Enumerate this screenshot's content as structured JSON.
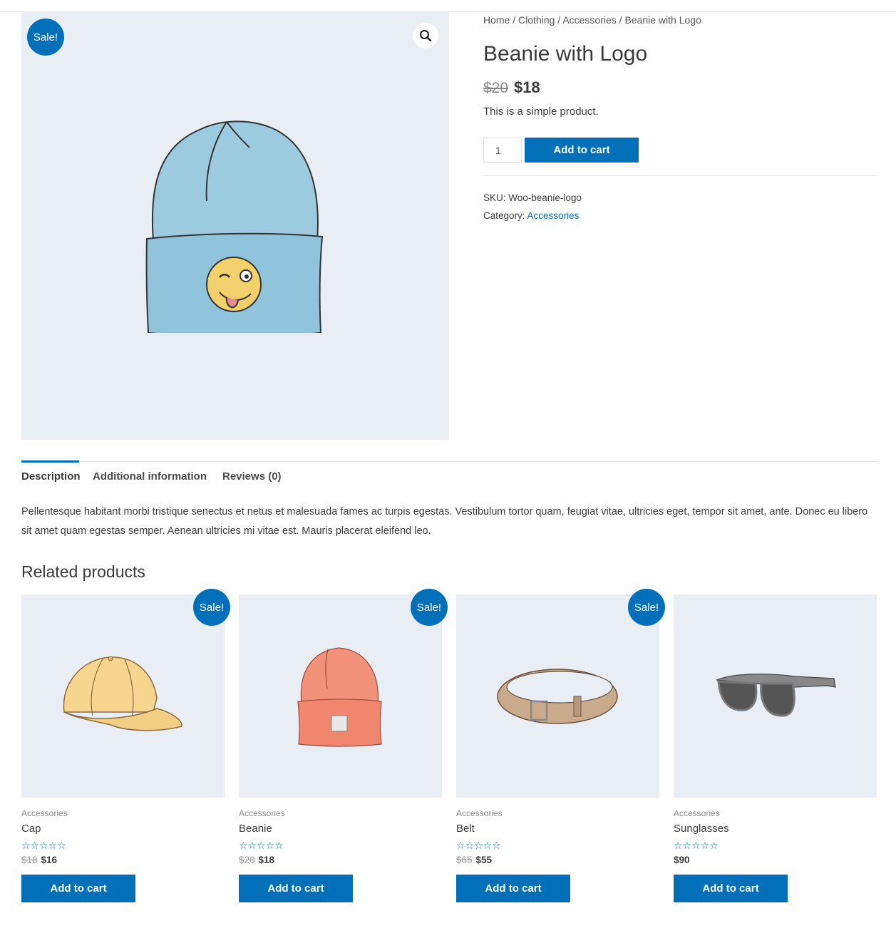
{
  "breadcrumb": {
    "items": [
      "Home",
      "Clothing",
      "Accessories",
      "Beanie with Logo"
    ],
    "separator": "/"
  },
  "product": {
    "title": "Beanie with Logo",
    "old_price": "$20",
    "new_price": "$18",
    "short_description": "This is a simple product.",
    "quantity": "1",
    "add_to_cart_label": "Add to cart",
    "sale_label": "Sale!",
    "sku_label": "SKU:",
    "sku": "Woo-beanie-logo",
    "category_label": "Category:",
    "category": "Accessories"
  },
  "tabs": [
    {
      "label": "Description",
      "active": true
    },
    {
      "label": "Additional information",
      "active": false
    },
    {
      "label": "Reviews (0)",
      "active": false
    }
  ],
  "description": "Pellentesque habitant morbi tristique senectus et netus et malesuada fames ac turpis egestas. Vestibulum tortor quam, feugiat vitae, ultricies eget, tempor sit amet, ante. Donec eu libero sit amet quam egestas semper. Aenean ultricies mi vitae est. Mauris placerat eleifend leo.",
  "related": {
    "title": "Related products",
    "products": [
      {
        "category": "Accessories",
        "name": "Cap",
        "old_price": "$18",
        "new_price": "$16",
        "sale": "Sale!",
        "rating": 0,
        "button": "Add to cart"
      },
      {
        "category": "Accessories",
        "name": "Beanie",
        "old_price": "$20",
        "new_price": "$18",
        "sale": "Sale!",
        "rating": 0,
        "button": "Add to cart"
      },
      {
        "category": "Accessories",
        "name": "Belt",
        "old_price": "$65",
        "new_price": "$55",
        "sale": "Sale!",
        "rating": 0,
        "button": "Add to cart"
      },
      {
        "category": "Accessories",
        "name": "Sunglasses",
        "old_price": "",
        "new_price": "$90",
        "sale": "",
        "rating": 0,
        "button": "Add to cart"
      }
    ]
  },
  "icons": {
    "zoom": "search-icon",
    "stars": "star-outline-icon"
  },
  "colors": {
    "accent": "#0170b9",
    "image_bg": "#e8eef3",
    "text": "#3a3a3a"
  }
}
